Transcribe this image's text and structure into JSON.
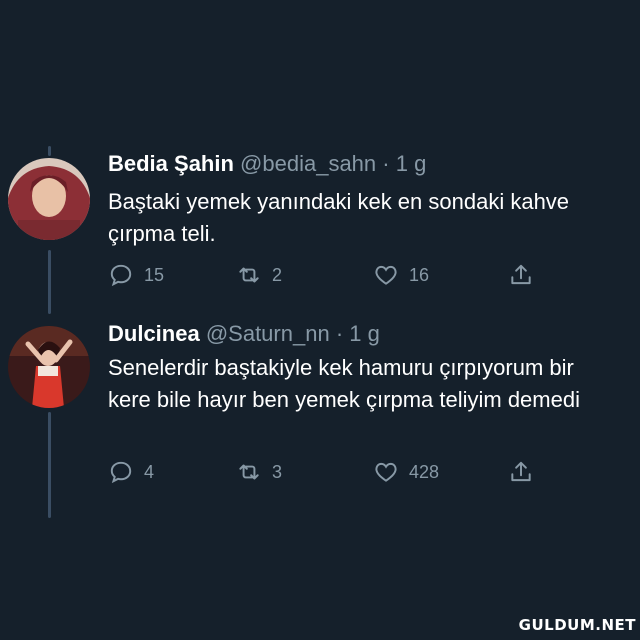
{
  "tweets": [
    {
      "name": "Bedia Şahin",
      "handle": "@bedia_sahn",
      "time": "· 1 g",
      "text": "Baştaki yemek yanındaki kek en sondaki kahve çırpma teli.",
      "replies": "15",
      "retweets": "2",
      "likes": "16"
    },
    {
      "name": "Dulcinea",
      "handle": "@Saturn_nn",
      "time": "· 1 g",
      "text": "Senelerdir baştakiyle kek hamuru çırpıyorum bir kere bile hayır ben yemek çırpma teliyim demedi",
      "replies": "4",
      "retweets": "3",
      "likes": "428"
    }
  ],
  "watermark": "GULDUM.NET",
  "colors": {
    "background": "#15202b",
    "secondary_text": "#8899a6",
    "thread_line": "#3a4d63"
  }
}
